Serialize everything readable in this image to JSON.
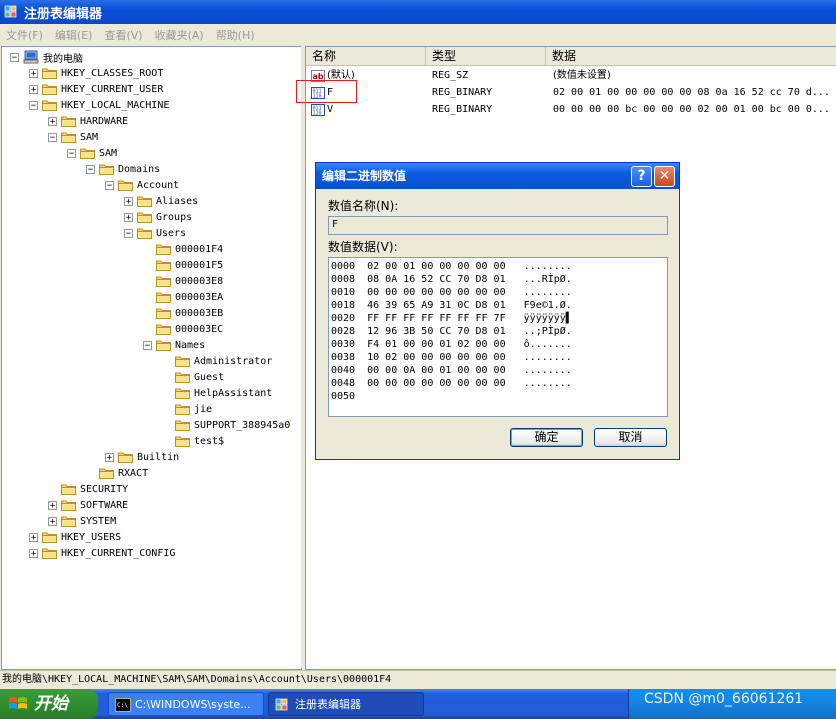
{
  "window": {
    "title": "注册表编辑器"
  },
  "menu": [
    "文件(F)",
    "编辑(E)",
    "查看(V)",
    "收藏夹(A)",
    "帮助(H)"
  ],
  "tree": {
    "nodes": [
      {
        "label": "我的电脑",
        "depth": 0,
        "exp": "-",
        "icon": "computer"
      },
      {
        "label": "HKEY_CLASSES_ROOT",
        "depth": 1,
        "exp": "+"
      },
      {
        "label": "HKEY_CURRENT_USER",
        "depth": 1,
        "exp": "+"
      },
      {
        "label": "HKEY_LOCAL_MACHINE",
        "depth": 1,
        "exp": "-"
      },
      {
        "label": "HARDWARE",
        "depth": 2,
        "exp": "+"
      },
      {
        "label": "SAM",
        "depth": 2,
        "exp": "-"
      },
      {
        "label": "SAM",
        "depth": 3,
        "exp": "-"
      },
      {
        "label": "Domains",
        "depth": 4,
        "exp": "-"
      },
      {
        "label": "Account",
        "depth": 5,
        "exp": "-"
      },
      {
        "label": "Aliases",
        "depth": 6,
        "exp": "+"
      },
      {
        "label": "Groups",
        "depth": 6,
        "exp": "+"
      },
      {
        "label": "Users",
        "depth": 6,
        "exp": "-"
      },
      {
        "label": "000001F4",
        "depth": 7,
        "exp": ""
      },
      {
        "label": "000001F5",
        "depth": 7,
        "exp": ""
      },
      {
        "label": "000003E8",
        "depth": 7,
        "exp": ""
      },
      {
        "label": "000003EA",
        "depth": 7,
        "exp": ""
      },
      {
        "label": "000003EB",
        "depth": 7,
        "exp": ""
      },
      {
        "label": "000003EC",
        "depth": 7,
        "exp": ""
      },
      {
        "label": "Names",
        "depth": 7,
        "exp": "-"
      },
      {
        "label": "Administrator",
        "depth": 8,
        "exp": ""
      },
      {
        "label": "Guest",
        "depth": 8,
        "exp": ""
      },
      {
        "label": "HelpAssistant",
        "depth": 8,
        "exp": ""
      },
      {
        "label": "jie",
        "depth": 8,
        "exp": ""
      },
      {
        "label": "SUPPORT_388945a0",
        "depth": 8,
        "exp": ""
      },
      {
        "label": "test$",
        "depth": 8,
        "exp": ""
      },
      {
        "label": "Builtin",
        "depth": 5,
        "exp": "+"
      },
      {
        "label": "RXACT",
        "depth": 4,
        "exp": ""
      },
      {
        "label": "SECURITY",
        "depth": 2,
        "exp": ""
      },
      {
        "label": "SOFTWARE",
        "depth": 2,
        "exp": "+"
      },
      {
        "label": "SYSTEM",
        "depth": 2,
        "exp": "+"
      },
      {
        "label": "HKEY_USERS",
        "depth": 1,
        "exp": "+"
      },
      {
        "label": "HKEY_CURRENT_CONFIG",
        "depth": 1,
        "exp": "+"
      }
    ]
  },
  "list": {
    "headers": {
      "name": "名称",
      "type": "类型",
      "data": "数据"
    },
    "rows": [
      {
        "name": "(默认)",
        "type": "REG_SZ",
        "data": "(数值未设置)",
        "icon": "ab"
      },
      {
        "name": "F",
        "type": "REG_BINARY",
        "data": "02 00 01 00 00 00 00 00 08 0a 16 52 cc 70 d...",
        "icon": "bin"
      },
      {
        "name": "V",
        "type": "REG_BINARY",
        "data": "00 00 00 00 bc 00 00 00 02 00 01 00 bc 00 0...",
        "icon": "bin"
      }
    ]
  },
  "dialog": {
    "title": "编辑二进制数值",
    "help": "?",
    "close": "✕",
    "name_label": "数值名称(N):",
    "name_value": "F",
    "data_label": "数值数据(V):",
    "hex_lines": [
      "0000  02 00 01 00 00 00 00 00   ........",
      "0008  08 0A 16 52 CC 70 D8 01   ...RÌpØ.",
      "0010  00 00 00 00 00 00 00 00   ........",
      "0018  46 39 65 A9 31 0C D8 01   F9e©1.Ø.",
      "0020  FF FF FF FF FF FF FF 7F   ÿÿÿÿÿÿÿ▌",
      "0028  12 96 3B 50 CC 70 D8 01   ..;PÌpØ.",
      "0030  F4 01 00 00 01 02 00 00   ô.......",
      "0038  10 02 00 00 00 00 00 00   ........",
      "0040  00 00 0A 00 01 00 00 00   ........",
      "0048  00 00 00 00 00 00 00 00   ........",
      "0050"
    ],
    "ok": "确定",
    "cancel": "取消"
  },
  "status": "我的电脑\\HKEY_LOCAL_MACHINE\\SAM\\SAM\\Domains\\Account\\Users\\000001F4",
  "taskbar": {
    "start": "开始",
    "tasks": [
      "C:\\WINDOWS\\syste...",
      "注册表编辑器"
    ]
  },
  "watermark": "CSDN @m0_66061261"
}
